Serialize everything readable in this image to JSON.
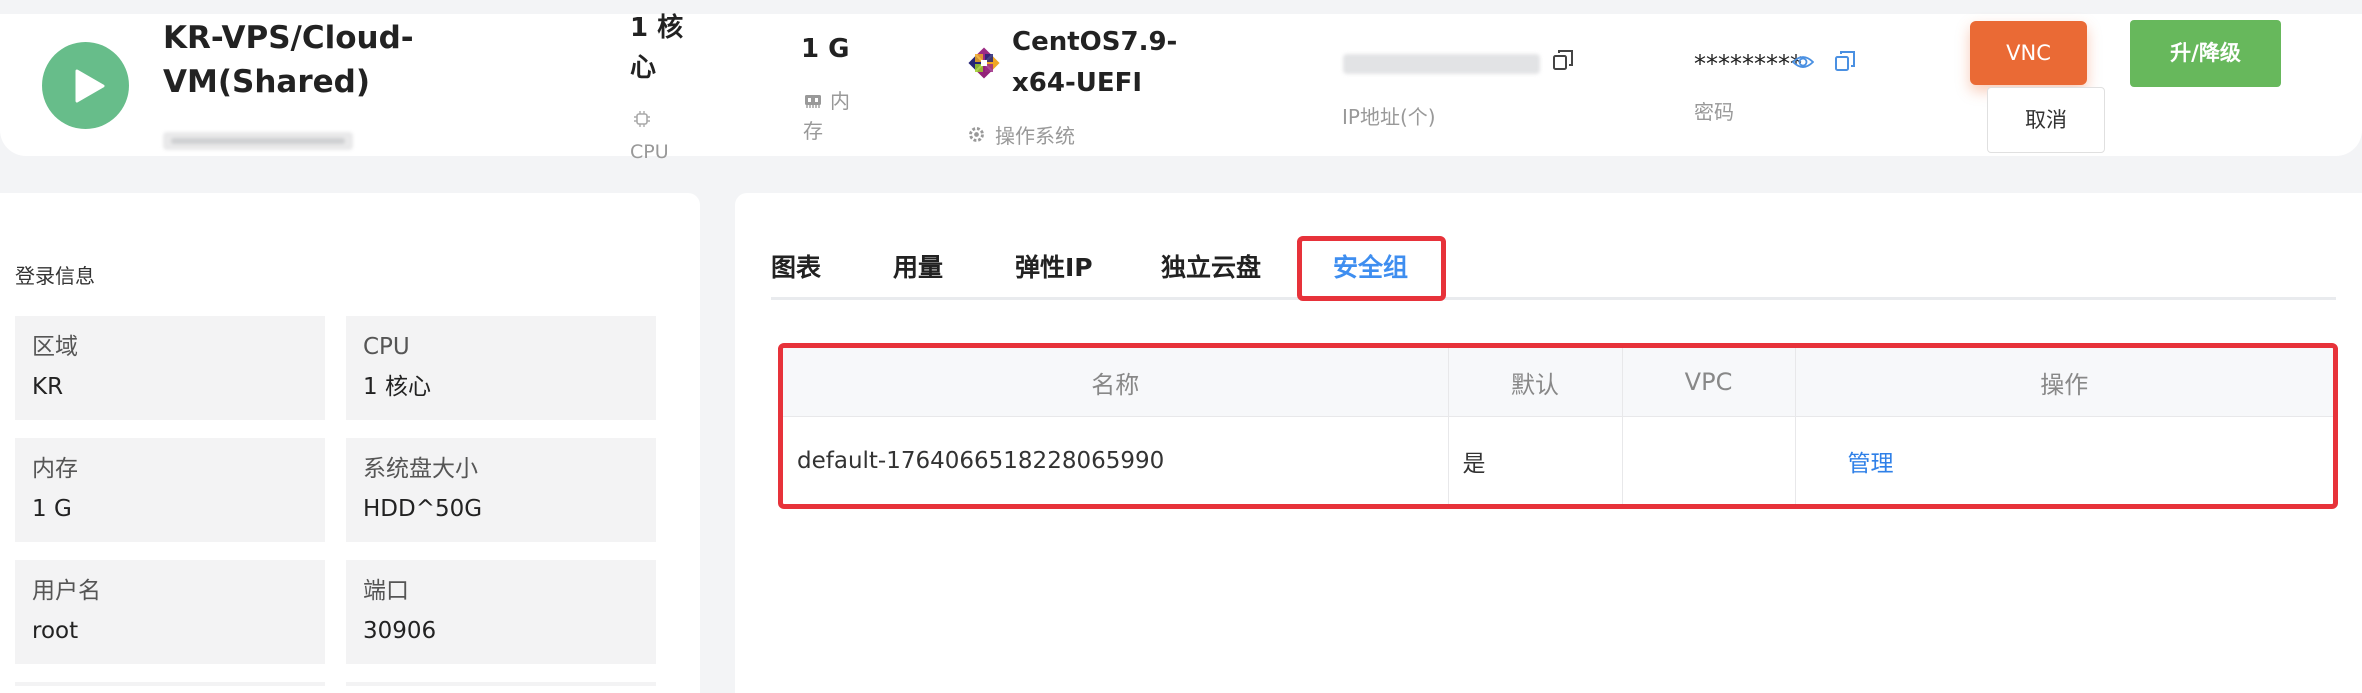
{
  "vm": {
    "name_line1": "KR-VPS/Cloud-",
    "name_line2": "VM(Shared)"
  },
  "specs": {
    "cpu_value_line1": "1 核",
    "cpu_value_line2": "心",
    "cpu_label": "CPU",
    "memory_value": "1 G",
    "memory_label_line1": "内",
    "memory_label_line2": "存",
    "os_value_line1": "CentOS7.9-",
    "os_value_line2": "x64-UEFI",
    "os_label": "操作系统",
    "ip_label": "IP地址(个)",
    "password_value": "*********",
    "password_label": "密码"
  },
  "actions": {
    "vnc_label": "VNC",
    "upgrade_label": "升/降级",
    "cancel_label": "取消"
  },
  "login_info": {
    "title": "登录信息",
    "items": [
      {
        "label": "区域",
        "value": "KR"
      },
      {
        "label": "CPU",
        "value": "1 核心"
      },
      {
        "label": "内存",
        "value": "1 G"
      },
      {
        "label": "系统盘大小",
        "value": "HDD^50G"
      },
      {
        "label": "用户名",
        "value": "root"
      },
      {
        "label": "端口",
        "value": "30906"
      }
    ]
  },
  "tabs": [
    "图表",
    "用量",
    "弹性IP",
    "独立云盘",
    "安全组"
  ],
  "active_tab": "安全组",
  "security_group_table": {
    "headers": [
      "名称",
      "默认",
      "VPC",
      "操作"
    ],
    "rows": [
      {
        "name": "default-1764066518228065990",
        "default": "是",
        "vpc": "",
        "action": "管理"
      }
    ]
  },
  "colors": {
    "play": "#67bd8a",
    "vnc": "#ea6a35",
    "upgrade": "#67b85c",
    "accent": "#3e8ef0",
    "highlight": "#e7323a"
  }
}
